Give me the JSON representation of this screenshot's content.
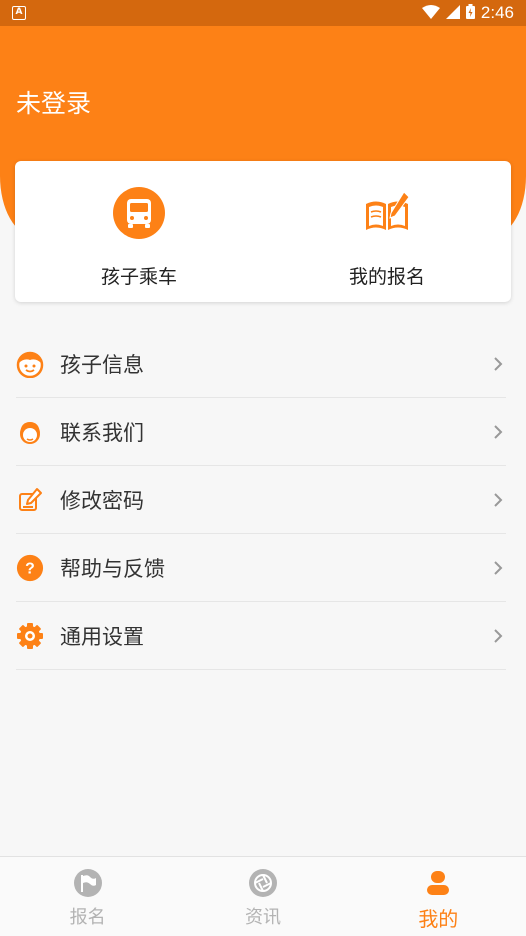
{
  "status_bar": {
    "time": "2:46",
    "app_icon_letter": "A"
  },
  "header": {
    "user_status": "未登录"
  },
  "quick_actions": [
    {
      "label": "孩子乘车",
      "icon": "bus-icon"
    },
    {
      "label": "我的报名",
      "icon": "notebook-pen-icon"
    }
  ],
  "menu": [
    {
      "label": "孩子信息",
      "icon": "child-face-icon"
    },
    {
      "label": "联系我们",
      "icon": "customer-service-icon"
    },
    {
      "label": "修改密码",
      "icon": "edit-password-icon"
    },
    {
      "label": "帮助与反馈",
      "icon": "help-question-icon"
    },
    {
      "label": "通用设置",
      "icon": "settings-gear-icon"
    }
  ],
  "tabs": [
    {
      "label": "报名",
      "icon": "flag-icon",
      "active": false
    },
    {
      "label": "资讯",
      "icon": "shutter-icon",
      "active": false
    },
    {
      "label": "我的",
      "icon": "user-icon",
      "active": true
    }
  ],
  "colors": {
    "accent": "#fd8116",
    "status_bar": "#d4680e",
    "inactive_tab": "#b3b3b3"
  }
}
